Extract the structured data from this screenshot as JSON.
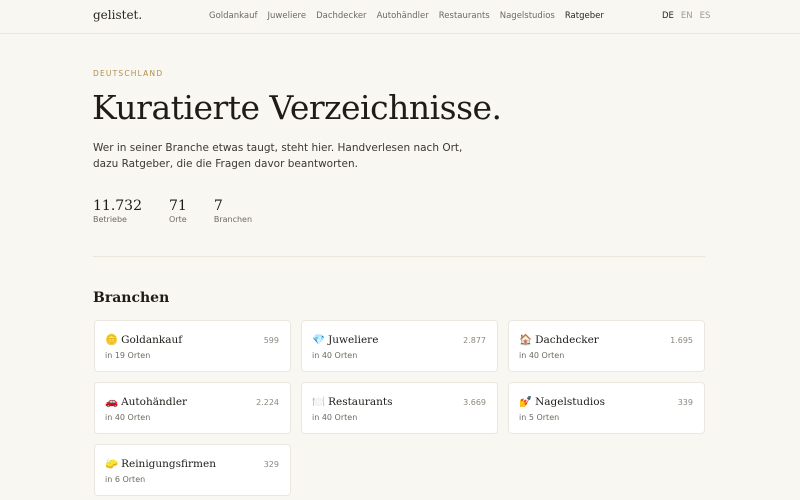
{
  "header": {
    "logo": "gelistet.",
    "nav": [
      "Goldankauf",
      "Juweliere",
      "Dachdecker",
      "Autohändler",
      "Restaurants",
      "Nagelstudios",
      "Ratgeber"
    ],
    "active_nav": "Ratgeber",
    "languages": [
      "DE",
      "EN",
      "ES"
    ],
    "active_language": "DE"
  },
  "hero": {
    "eyebrow": "DEUTSCHLAND",
    "headline": "Kuratierte Verzeichnisse.",
    "lede_line1": "Wer in seiner Branche etwas taugt, steht hier. Handverlesen nach Ort,",
    "lede_line2": "dazu Ratgeber, die die Fragen davor beantworten."
  },
  "stats": [
    {
      "value": "11.732",
      "label": "Betriebe"
    },
    {
      "value": "71",
      "label": "Orte"
    },
    {
      "value": "7",
      "label": "Branchen"
    }
  ],
  "branches": {
    "title": "Branchen",
    "items": [
      {
        "icon": "gold-coin-icon",
        "emoji": "🪙",
        "name": "Goldankauf",
        "count": "599",
        "sub": "in 19 Orten"
      },
      {
        "icon": "diamond-icon",
        "emoji": "💎",
        "name": "Juweliere",
        "count": "2.877",
        "sub": "in 40 Orten"
      },
      {
        "icon": "house-icon",
        "emoji": "🏠",
        "name": "Dachdecker",
        "count": "1.695",
        "sub": "in 40 Orten"
      },
      {
        "icon": "car-icon",
        "emoji": "🚗",
        "name": "Autohändler",
        "count": "2.224",
        "sub": "in 40 Orten"
      },
      {
        "icon": "plate-icon",
        "emoji": "🍽️",
        "name": "Restaurants",
        "count": "3.669",
        "sub": "in 40 Orten"
      },
      {
        "icon": "nail-polish-icon",
        "emoji": "💅",
        "name": "Nagelstudios",
        "count": "339",
        "sub": "in 5 Orten"
      },
      {
        "icon": "sponge-icon",
        "emoji": "🧽",
        "name": "Reinigungsfirmen",
        "count": "329",
        "sub": "in 6 Orten"
      }
    ]
  }
}
